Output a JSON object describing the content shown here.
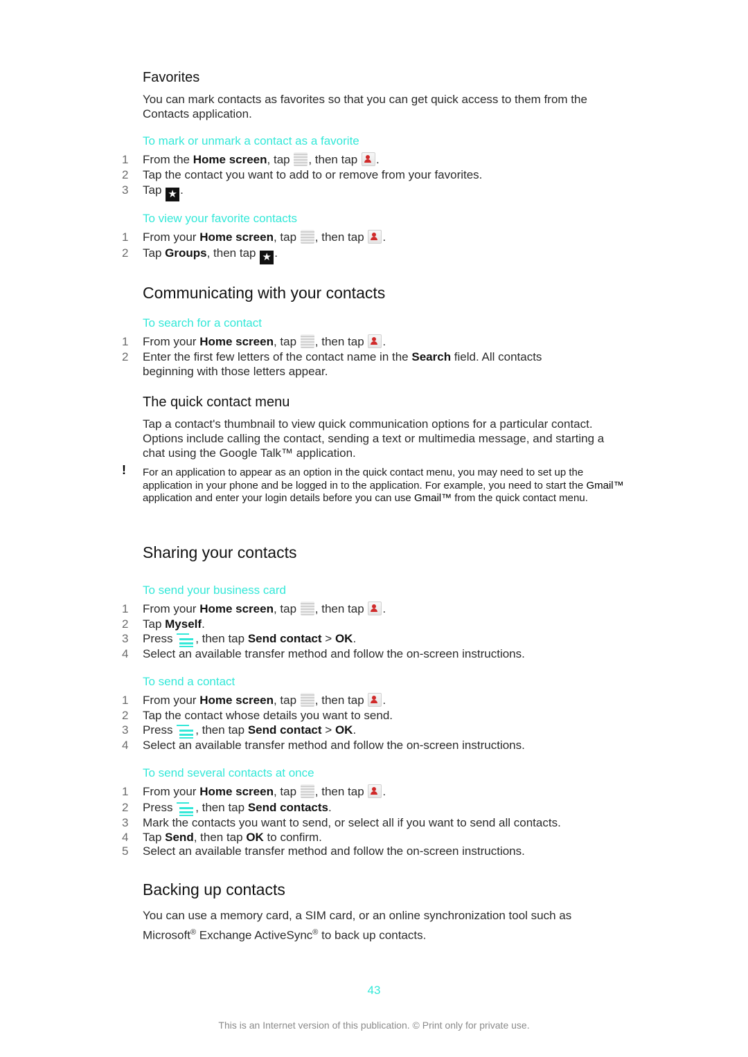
{
  "favorites": {
    "heading": "Favorites",
    "intro": "You can mark contacts as favorites so that you can get quick access to them from the Contacts application.",
    "mark_task": {
      "title": "To mark or unmark a contact as a favorite",
      "steps": [
        {
          "num": "1",
          "pre": "From the ",
          "bold": "Home screen",
          "mid": ", tap ",
          "mid2": ", then tap ",
          "post": "."
        },
        {
          "num": "2",
          "text": "Tap the contact you want to add to or remove from your favorites."
        },
        {
          "num": "3",
          "pre": "Tap ",
          "post": "."
        }
      ]
    },
    "view_task": {
      "title": "To view your favorite contacts",
      "steps": [
        {
          "num": "1",
          "pre": "From your ",
          "bold": "Home screen",
          "mid": ", tap ",
          "mid2": ", then tap ",
          "post": "."
        },
        {
          "num": "2",
          "pre": "Tap ",
          "bold": "Groups",
          "mid": ", then tap ",
          "post": "."
        }
      ]
    }
  },
  "communicating": {
    "heading": "Communicating with your contacts",
    "search_task": {
      "title": "To search for a contact",
      "steps": [
        {
          "num": "1",
          "pre": "From your ",
          "bold": "Home screen",
          "mid": ", tap ",
          "mid2": ", then tap ",
          "post": "."
        },
        {
          "num": "2",
          "pre": "Enter the first few letters of the contact name in the ",
          "bold": "Search",
          "post": " field. All contacts beginning with those letters appear."
        }
      ]
    }
  },
  "quick_menu": {
    "heading": "The quick contact menu",
    "body": "Tap a contact's thumbnail to view quick communication options for a particular contact. Options include calling the contact, sending a text or multimedia message, and starting a chat using the Google Talk™ application.",
    "note": {
      "icon": "exclamation-icon",
      "p1": "For an application to appear as an option in the quick contact menu, you may need to set up the application in your phone and be logged in to the application. For example, you need to start the ",
      "b1": "Gmail™",
      "p2": " application and enter your login details before you can use ",
      "b2": "Gmail™",
      "p3": " from the quick contact menu."
    }
  },
  "sharing": {
    "heading": "Sharing your contacts",
    "business_card_task": {
      "title": "To send your business card",
      "steps": [
        {
          "num": "1",
          "pre": "From your ",
          "bold": "Home screen",
          "mid": ", tap ",
          "mid2": ", then tap ",
          "post": "."
        },
        {
          "num": "2",
          "pre": "Tap ",
          "bold": "Myself",
          "post": "."
        },
        {
          "num": "3",
          "pre": "Press ",
          "mid": ", then tap ",
          "bold": "Send contact",
          "sep": " > ",
          "bold2": "OK",
          "post": "."
        },
        {
          "num": "4",
          "text": "Select an available transfer method and follow the on-screen instructions."
        }
      ]
    },
    "send_contact_task": {
      "title": "To send a contact",
      "steps": [
        {
          "num": "1",
          "pre": "From your ",
          "bold": "Home screen",
          "mid": ", tap ",
          "mid2": ", then tap ",
          "post": "."
        },
        {
          "num": "2",
          "text": "Tap the contact whose details you want to send."
        },
        {
          "num": "3",
          "pre": "Press ",
          "mid": ", then tap ",
          "bold": "Send contact",
          "sep": " > ",
          "bold2": "OK",
          "post": "."
        },
        {
          "num": "4",
          "text": "Select an available transfer method and follow the on-screen instructions."
        }
      ]
    },
    "send_several_task": {
      "title": "To send several contacts at once",
      "steps": [
        {
          "num": "1",
          "pre": "From your ",
          "bold": "Home screen",
          "mid": ", tap ",
          "mid2": ", then tap ",
          "post": "."
        },
        {
          "num": "2",
          "pre": "Press ",
          "mid": ", then tap ",
          "bold": "Send contacts",
          "post": "."
        },
        {
          "num": "3",
          "text": "Mark the contacts you want to send, or select all if you want to send all contacts."
        },
        {
          "num": "4",
          "pre": "Tap ",
          "bold": "Send",
          "mid": ", then tap ",
          "bold2": "OK",
          "post": " to confirm."
        },
        {
          "num": "5",
          "text": "Select an available transfer method and follow the on-screen instructions."
        }
      ]
    }
  },
  "backup": {
    "heading": "Backing up contacts",
    "p1": "You can use a memory card, a SIM card, or an online synchronization tool such as Microsoft",
    "reg": "®",
    "p2": " Exchange ActiveSync",
    "p3": " to back up contacts."
  },
  "page_number": "43",
  "footer": "This is an Internet version of this publication. © Print only for private use.",
  "colors": {
    "accent": "#33e8d8",
    "text": "#2a2a2a",
    "footer": "#8a8a8a"
  }
}
